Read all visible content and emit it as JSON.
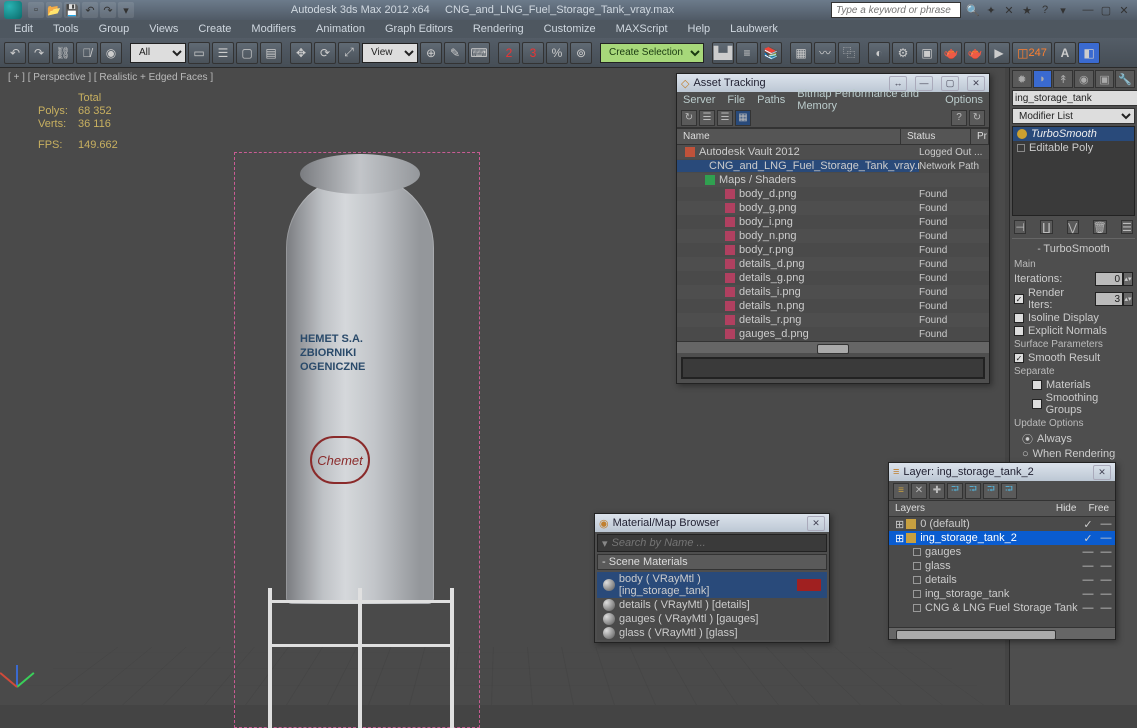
{
  "titlebar": {
    "app": "Autodesk 3ds Max 2012 x64",
    "file": "CNG_and_LNG_Fuel_Storage_Tank_vray.max",
    "search_placeholder": "Type a keyword or phrase"
  },
  "menus": [
    "Edit",
    "Tools",
    "Group",
    "Views",
    "Create",
    "Modifiers",
    "Animation",
    "Graph Editors",
    "Rendering",
    "Customize",
    "MAXScript",
    "Help",
    "Laubwerk"
  ],
  "toolbar": {
    "dd1": "All",
    "dd2": "View",
    "dd3": "Create Selection Se",
    "polycount": "247"
  },
  "viewport": {
    "label": "[ + ] [ Perspective ] [ Realistic + Edged Faces ]",
    "stats_hdr": "Total",
    "polys_lbl": "Polys:",
    "polys_val": "68 352",
    "verts_lbl": "Verts:",
    "verts_val": "36 116",
    "fps_lbl": "FPS:",
    "fps_val": "149.662",
    "tank_text_l1": "HEMET S.A.",
    "tank_text_l2": "ZBIORNIKI",
    "tank_text_l3": "OGENICZNE",
    "logo_text": "Chemet"
  },
  "cmd": {
    "obj_name": "ing_storage_tank",
    "modlist": "Modifier List",
    "stack": [
      {
        "name": "TurboSmooth",
        "sel": true,
        "bulb": true
      },
      {
        "name": "Editable Poly",
        "sel": false,
        "bulb": false
      }
    ],
    "rollout_title": "TurboSmooth",
    "main_lbl": "Main",
    "iter_lbl": "Iterations:",
    "iter_val": "0",
    "rend_lbl": "Render Iters:",
    "rend_val": "3",
    "isoline": "Isoline Display",
    "exnorm": "Explicit Normals",
    "surf_lbl": "Surface Parameters",
    "smooth": "Smooth Result",
    "sep_lbl": "Separate",
    "materials": "Materials",
    "sgroups": "Smoothing Groups",
    "upd_lbl": "Update Options",
    "always": "Always",
    "whenrender": "When Rendering"
  },
  "asset": {
    "title": "Asset Tracking",
    "menus": [
      "Server",
      "File",
      "Paths",
      "Bitmap Performance and Memory",
      "Options"
    ],
    "col_name": "Name",
    "col_status": "Status",
    "col_p": "Pr",
    "rows": [
      {
        "indent": 0,
        "name": "Autodesk Vault 2012",
        "status": "Logged Out ...",
        "icon": "vault"
      },
      {
        "indent": 1,
        "name": "CNG_and_LNG_Fuel_Storage_Tank_vray.max",
        "status": "Network Path",
        "icon": "max",
        "hl": true
      },
      {
        "indent": 1,
        "name": "Maps / Shaders",
        "status": "",
        "icon": "folder"
      },
      {
        "indent": 2,
        "name": "body_d.png",
        "status": "Found",
        "icon": "img"
      },
      {
        "indent": 2,
        "name": "body_g.png",
        "status": "Found",
        "icon": "img"
      },
      {
        "indent": 2,
        "name": "body_i.png",
        "status": "Found",
        "icon": "img"
      },
      {
        "indent": 2,
        "name": "body_n.png",
        "status": "Found",
        "icon": "img"
      },
      {
        "indent": 2,
        "name": "body_r.png",
        "status": "Found",
        "icon": "img"
      },
      {
        "indent": 2,
        "name": "details_d.png",
        "status": "Found",
        "icon": "img"
      },
      {
        "indent": 2,
        "name": "details_g.png",
        "status": "Found",
        "icon": "img"
      },
      {
        "indent": 2,
        "name": "details_i.png",
        "status": "Found",
        "icon": "img"
      },
      {
        "indent": 2,
        "name": "details_n.png",
        "status": "Found",
        "icon": "img"
      },
      {
        "indent": 2,
        "name": "details_r.png",
        "status": "Found",
        "icon": "img"
      },
      {
        "indent": 2,
        "name": "gauges_d.png",
        "status": "Found",
        "icon": "img"
      }
    ]
  },
  "matbrowser": {
    "title": "Material/Map Browser",
    "search_placeholder": "Search by Name ...",
    "section": "Scene Materials",
    "items": [
      {
        "name": "body ( VRayMtl ) [ing_storage_tank]",
        "sel": true,
        "hot": true
      },
      {
        "name": "details ( VRayMtl ) [details]"
      },
      {
        "name": "gauges ( VRayMtl ) [gauges]"
      },
      {
        "name": "glass ( VRayMtl ) [glass]"
      }
    ]
  },
  "layer": {
    "title": "Layer: ing_storage_tank_2",
    "col_layers": "Layers",
    "col_hide": "Hide",
    "col_free": "Free",
    "rows": [
      {
        "name": "0 (default)",
        "indent": 0,
        "type": "layer",
        "sel": false,
        "tick": true
      },
      {
        "name": "ing_storage_tank_2",
        "indent": 0,
        "type": "layer",
        "sel": true,
        "tick": true
      },
      {
        "name": "gauges",
        "indent": 1,
        "type": "obj"
      },
      {
        "name": "glass",
        "indent": 1,
        "type": "obj"
      },
      {
        "name": "details",
        "indent": 1,
        "type": "obj"
      },
      {
        "name": "ing_storage_tank",
        "indent": 1,
        "type": "obj"
      },
      {
        "name": "CNG & LNG Fuel Storage Tank",
        "indent": 1,
        "type": "obj"
      }
    ]
  }
}
